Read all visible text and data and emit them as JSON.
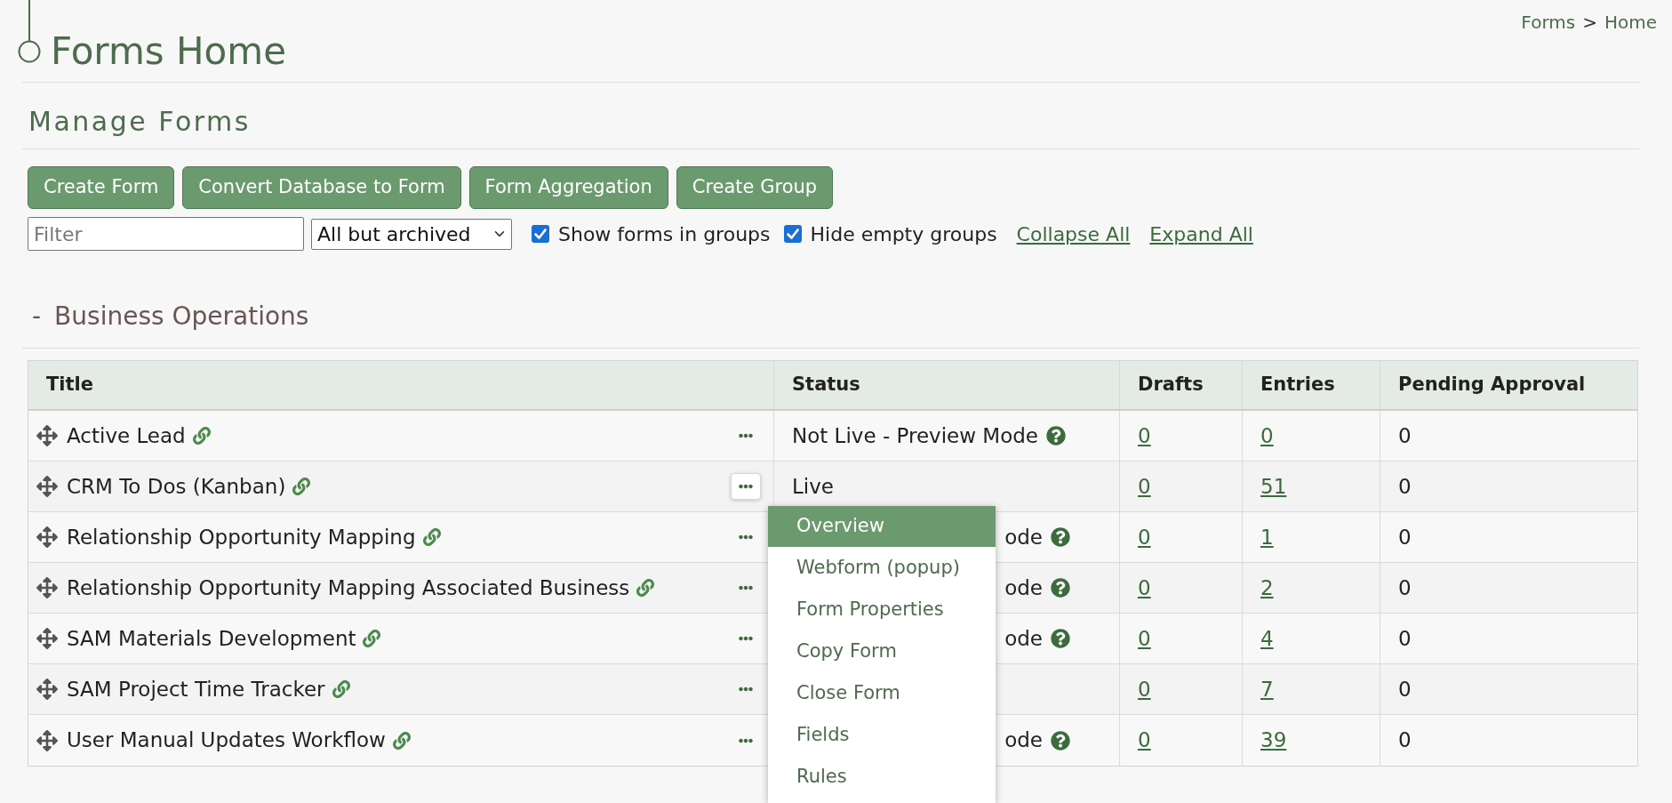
{
  "breadcrumb": {
    "items": [
      "Forms",
      "Home"
    ],
    "separator": ">"
  },
  "page_title": "Forms Home",
  "section_title": "Manage Forms",
  "buttons": [
    "Create Form",
    "Convert Database to Form",
    "Form Aggregation",
    "Create Group"
  ],
  "filter": {
    "placeholder": "Filter"
  },
  "status_select": {
    "value": "All but archived"
  },
  "checkboxes": [
    {
      "label": "Show forms in groups",
      "checked": true
    },
    {
      "label": "Hide empty groups",
      "checked": true
    }
  ],
  "links": [
    "Collapse All",
    "Expand All"
  ],
  "group": {
    "toggle": "-",
    "name": "Business Operations"
  },
  "table": {
    "columns": [
      "Title",
      "Status",
      "Drafts",
      "Entries",
      "Pending Approval"
    ],
    "rows": [
      {
        "title": "Active Lead",
        "status": "Not Live - Preview Mode",
        "help": true,
        "drafts": "0",
        "entries": "0",
        "pending": "0",
        "menu_open": false
      },
      {
        "title": "CRM To Dos (Kanban)",
        "status": "Live",
        "help": false,
        "drafts": "0",
        "entries": "51",
        "pending": "0",
        "menu_open": true
      },
      {
        "title": "Relationship Opportunity Mapping",
        "status": "ode",
        "help": true,
        "drafts": "0",
        "entries": "1",
        "pending": "0",
        "menu_open": false
      },
      {
        "title": "Relationship Opportunity Mapping Associated Business",
        "status": "ode",
        "help": true,
        "drafts": "0",
        "entries": "2",
        "pending": "0",
        "menu_open": false
      },
      {
        "title": "SAM Materials Development",
        "status": "ode",
        "help": true,
        "drafts": "0",
        "entries": "4",
        "pending": "0",
        "menu_open": false
      },
      {
        "title": "SAM Project Time Tracker",
        "help": false,
        "drafts": "0",
        "entries": "7",
        "pending": "0",
        "menu_open": false
      },
      {
        "title": "User Manual Updates Workflow",
        "status": "ode",
        "help": true,
        "drafts": "0",
        "entries": "39",
        "pending": "0",
        "menu_open": false
      }
    ]
  },
  "context_menu": {
    "items": [
      {
        "label": "Overview",
        "selected": true
      },
      {
        "label": "Webform (popup)",
        "selected": false
      },
      {
        "label": "Form Properties",
        "selected": false
      },
      {
        "label": "Copy Form",
        "selected": false
      },
      {
        "label": "Close Form",
        "selected": false
      },
      {
        "label": "Fields",
        "selected": false
      },
      {
        "label": "Rules",
        "selected": false
      }
    ]
  }
}
